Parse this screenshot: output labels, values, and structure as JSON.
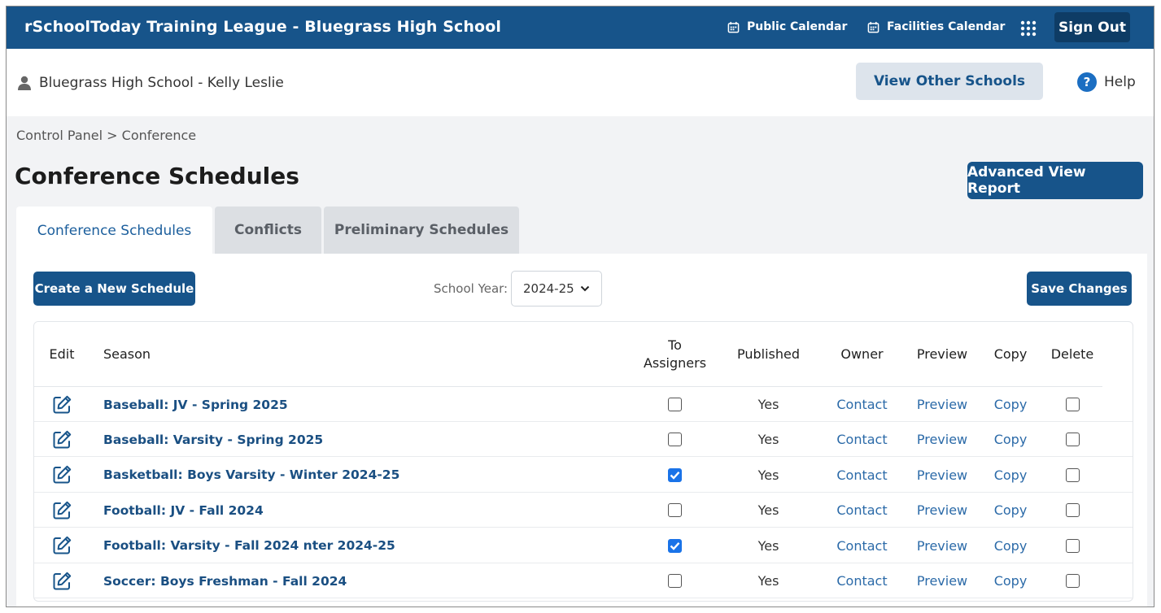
{
  "app": {
    "title": "rSchoolToday Training League - Bluegrass High School",
    "public_calendar": "Public Calendar",
    "facilities_calendar": "Facilities Calendar",
    "sign_out": "Sign Out"
  },
  "user": {
    "name": "Bluegrass High School - Kelly Leslie",
    "view_other_schools": "View Other Schools",
    "help": "Help"
  },
  "breadcrumb": "Control Panel > Conference",
  "page": {
    "title": "Conference Schedules",
    "advanced_view_report": "Advanced View Report"
  },
  "tabs": [
    {
      "label": "Conference Schedules",
      "active": true
    },
    {
      "label": "Conflicts",
      "active": false
    },
    {
      "label": "Preliminary Schedules",
      "active": false
    }
  ],
  "toolbar": {
    "create": "Create a New Schedule",
    "school_year_label": "School Year:",
    "school_year_value": "2024-25",
    "save": "Save Changes"
  },
  "table": {
    "headers": {
      "edit": "Edit",
      "season": "Season",
      "to_assigners_1": "To",
      "to_assigners_2": "Assigners",
      "published": "Published",
      "owner": "Owner",
      "preview": "Preview",
      "copy": "Copy",
      "delete": "Delete"
    },
    "rows": [
      {
        "season": "Baseball: JV - Spring 2025",
        "to_assigners": false,
        "published": "Yes",
        "owner": "Contact",
        "preview": "Preview",
        "copy": "Copy",
        "delete": false
      },
      {
        "season": "Baseball: Varsity - Spring 2025",
        "to_assigners": false,
        "published": "Yes",
        "owner": "Contact",
        "preview": "Preview",
        "copy": "Copy",
        "delete": false
      },
      {
        "season": "Basketball: Boys Varsity - Winter 2024-25",
        "to_assigners": true,
        "published": "Yes",
        "owner": "Contact",
        "preview": "Preview",
        "copy": "Copy",
        "delete": false
      },
      {
        "season": "Football: JV - Fall 2024",
        "to_assigners": false,
        "published": "Yes",
        "owner": "Contact",
        "preview": "Preview",
        "copy": "Copy",
        "delete": false
      },
      {
        "season": "Football: Varsity - Fall 2024   nter 2024-25",
        "to_assigners": true,
        "published": "Yes",
        "owner": "Contact",
        "preview": "Preview",
        "copy": "Copy",
        "delete": false
      },
      {
        "season": "Soccer: Boys Freshman - Fall 2024",
        "to_assigners": false,
        "published": "Yes",
        "owner": "Contact",
        "preview": "Preview",
        "copy": "Copy",
        "delete": false
      }
    ]
  },
  "colors": {
    "brand": "#17548a",
    "signout_bg": "#0e3c65",
    "link": "#2b6aa8",
    "checkbox_on": "#1a73e8"
  },
  "icons": [
    "calendar-icon",
    "apps-grid-icon",
    "person-icon",
    "help-icon",
    "chevron-down-icon",
    "edit-icon"
  ]
}
